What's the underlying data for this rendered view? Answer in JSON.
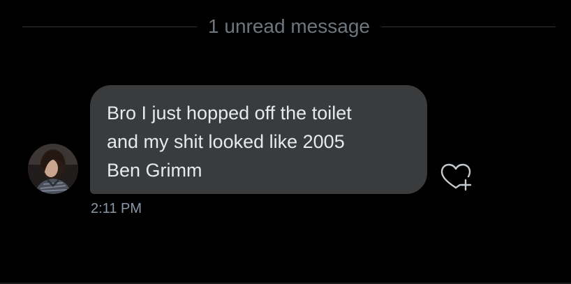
{
  "colors": {
    "background": "#000000",
    "divider": "#2f3336",
    "bubble": "#3a3b3d",
    "message_text": "#e7e9ea",
    "secondary_text": "#6e767d"
  },
  "unread_divider": {
    "label": "1 unread message"
  },
  "message": {
    "lines": [
      "Bro I just hopped off the toilet",
      "and my shit looked like 2005",
      "Ben Grimm"
    ],
    "timestamp": "2:11 PM",
    "sender_avatar_icon": "avatar-photo",
    "react_icon": "heart-plus-icon"
  }
}
